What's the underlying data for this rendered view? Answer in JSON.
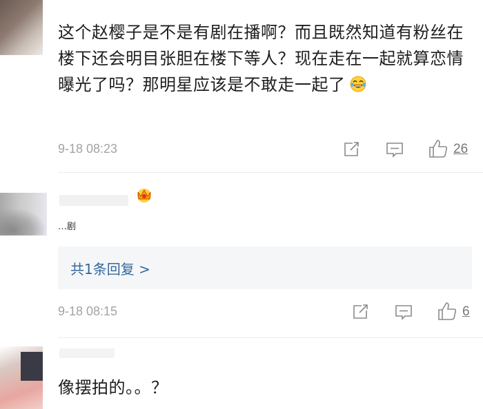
{
  "comments": [
    {
      "text": "这个赵樱子是不是有剧在播啊？而且既然知道有粉丝在楼下还会明目张胆在楼下等人？现在走在一起就算恋情曝光了吗？那明星应该是不敢走一起了",
      "emoji": "laugh-cry-emoji",
      "time": "9-18 08:23",
      "likes": "26"
    },
    {
      "text_snippet": "…剧",
      "badge": "vip-crown-icon",
      "reply_link": "共1条回复 >",
      "time": "9-18 08:15",
      "likes": "6"
    },
    {
      "text": "像摆拍的。。？"
    }
  ],
  "icons": {
    "share": "share-icon",
    "comment": "comment-icon",
    "like": "thumbs-up-icon"
  },
  "colors": {
    "link": "#33689c",
    "meta": "#a3a3a3",
    "reply_bg": "#f5f6f8"
  }
}
